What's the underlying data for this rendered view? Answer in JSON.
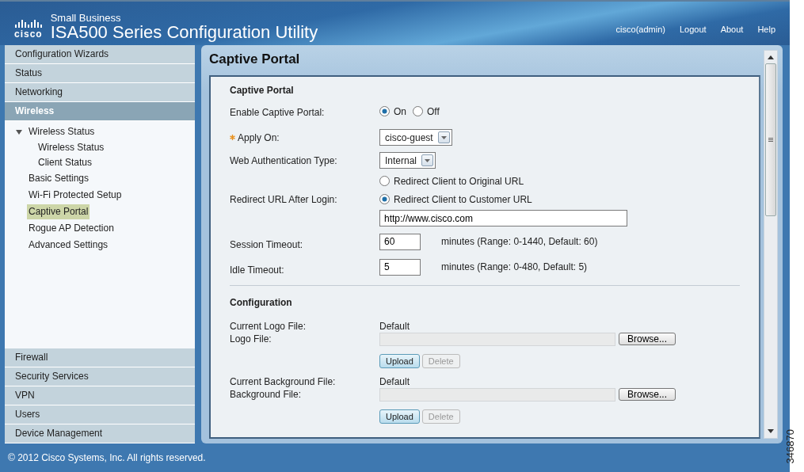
{
  "header": {
    "brand": "cisco",
    "subtitle": "Small Business",
    "title": "ISA500 Series Configuration Utility",
    "links": [
      "cisco(admin)",
      "Logout",
      "About",
      "Help"
    ]
  },
  "sidebar": {
    "top_sections": [
      {
        "label": "Configuration Wizards",
        "selected": false
      },
      {
        "label": "Status",
        "selected": false
      },
      {
        "label": "Networking",
        "selected": false
      },
      {
        "label": "Wireless",
        "selected": true
      }
    ],
    "tree": [
      {
        "label": "Wireless Status",
        "selected": false,
        "expanded": true,
        "children": [
          {
            "label": "Wireless Status",
            "selected": false
          },
          {
            "label": "Client Status",
            "selected": false
          }
        ]
      },
      {
        "label": "Basic Settings",
        "selected": false
      },
      {
        "label": "Wi-Fi Protected Setup",
        "selected": false
      },
      {
        "label": "Captive Portal",
        "selected": true
      },
      {
        "label": "Rogue AP Detection",
        "selected": false
      },
      {
        "label": "Advanced Settings",
        "selected": false
      }
    ],
    "bottom_sections": [
      {
        "label": "Firewall",
        "selected": false
      },
      {
        "label": "Security Services",
        "selected": false
      },
      {
        "label": "VPN",
        "selected": false
      },
      {
        "label": "Users",
        "selected": false
      },
      {
        "label": "Device Management",
        "selected": false
      }
    ]
  },
  "page": {
    "title": "Captive Portal",
    "settings": {
      "title": "Captive Portal",
      "rows": [
        {
          "kind": "radio",
          "label": "Enable Captive Portal:",
          "required": false,
          "options": [
            {
              "label": "On",
              "selected": true
            },
            {
              "label": "Off",
              "selected": false
            }
          ]
        },
        {
          "kind": "select",
          "label": "Apply On:",
          "required": true,
          "value": "cisco-guest"
        },
        {
          "kind": "select",
          "label": "Web Authentication Type:",
          "required": false,
          "value": "Internal"
        },
        {
          "kind": "redirect",
          "label": "Redirect URL After Login:",
          "required": false,
          "options": [
            {
              "label": "Redirect Client to Original URL",
              "selected": false
            },
            {
              "label": "Redirect Client to Customer URL",
              "selected": true
            }
          ],
          "value": "http://www.cisco.com"
        },
        {
          "kind": "number",
          "label": "Session Timeout:",
          "required": false,
          "value": "60",
          "hint": "minutes (Range: 0-1440, Default: 60)"
        },
        {
          "kind": "number",
          "label": "Idle Timeout:",
          "required": false,
          "value": "5",
          "hint": "minutes (Range: 0-480, Default: 5)"
        }
      ]
    },
    "configuration": {
      "title": "Configuration",
      "files": [
        {
          "current_label": "Current Logo File:",
          "current_value": "Default",
          "label": "Logo File:",
          "browse": "Browse...",
          "buttons": [
            {
              "label": "Upload",
              "disabled": false
            },
            {
              "label": "Delete",
              "disabled": true
            }
          ]
        },
        {
          "current_label": "Current Background File:",
          "current_value": "Default",
          "label": "Background File:",
          "browse": "Browse...",
          "buttons": [
            {
              "label": "Upload",
              "disabled": false
            },
            {
              "label": "Delete",
              "disabled": true
            }
          ]
        }
      ]
    }
  },
  "footer": "© 2012 Cisco Systems, Inc. All rights reserved.",
  "figure_id": "346870"
}
